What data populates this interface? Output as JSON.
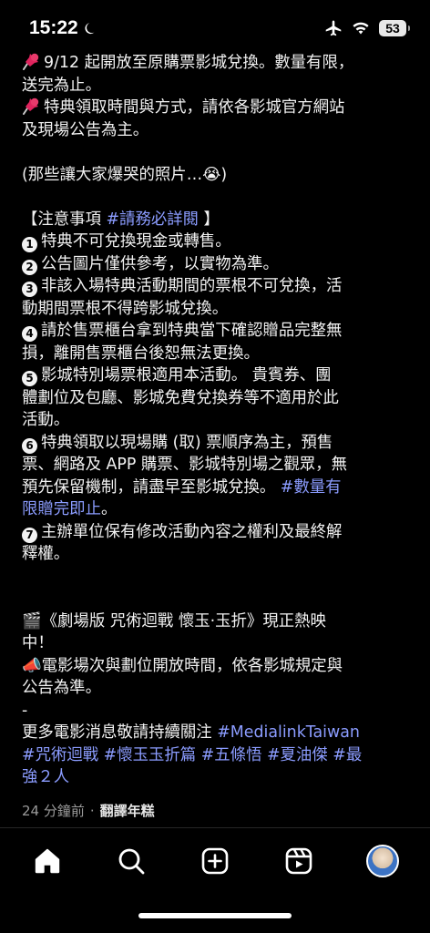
{
  "status_bar": {
    "time": "15:22",
    "battery": "53"
  },
  "post_lines": [
    [
      {
        "t": "pin"
      },
      {
        "s": "9/12 起開放至原購票影城兌換。數量有限，"
      }
    ],
    [
      {
        "s": "送完為止。"
      }
    ],
    [
      {
        "t": "pin"
      },
      {
        "s": "特典領取時間與方式，請依各影城官方網站"
      }
    ],
    [
      {
        "s": "及現場公告為主。"
      }
    ],
    [],
    [
      {
        "s": "(那些讓大家爆哭的照片…😭)"
      }
    ],
    [],
    [
      {
        "s": "【注意事項 "
      },
      {
        "tag": "#請務必詳閱"
      },
      {
        "s": " 】"
      }
    ],
    [
      {
        "n": "1"
      },
      {
        "s": "特典不可兌換現金或轉售。"
      }
    ],
    [
      {
        "n": "2"
      },
      {
        "s": "公告圖片僅供參考，以實物為準。"
      }
    ],
    [
      {
        "n": "3"
      },
      {
        "s": "非該入場特典活動期間的票根不可兌換，活"
      }
    ],
    [
      {
        "s": "動期間票根不得跨影城兌換。"
      }
    ],
    [
      {
        "n": "4"
      },
      {
        "s": "請於售票櫃台拿到特典當下確認贈品完整無"
      }
    ],
    [
      {
        "s": "損，離開售票櫃台後恕無法更換。"
      }
    ],
    [
      {
        "n": "5"
      },
      {
        "s": "影城特別場票根適用本活動。 貴賓券、團"
      }
    ],
    [
      {
        "s": "體劃位及包廳、影城免費兌換券等不適用於此"
      }
    ],
    [
      {
        "s": "活動。"
      }
    ],
    [
      {
        "n": "6"
      },
      {
        "s": "特典領取以現場購 (取) 票順序為主，預售"
      }
    ],
    [
      {
        "s": "票、網路及 APP 購票、影城特別場之觀眾，無"
      }
    ],
    [
      {
        "s": "預先保留機制，請盡早至影城兌換。 "
      },
      {
        "tag": "#數量有"
      }
    ],
    [
      {
        "tag": "限贈完即止"
      },
      {
        "s": "。"
      }
    ],
    [
      {
        "n": "7"
      },
      {
        "s": "主辦單位保有修改活動內容之權利及最終解"
      }
    ],
    [
      {
        "s": "釋權。"
      }
    ],
    [],
    [],
    [
      {
        "s": "🎬《劇場版 咒術迴戰 懷玉·玉折》現正熱映"
      }
    ],
    [
      {
        "s": "中！"
      }
    ],
    [
      {
        "s": "📣電影場次與劃位開放時間，依各影城規定與"
      }
    ],
    [
      {
        "s": "公告為準。"
      }
    ],
    [
      {
        "s": "-"
      }
    ],
    [
      {
        "s": "更多電影消息敬請持續關注 "
      },
      {
        "tag": "#MedialinkTaiwan"
      }
    ],
    [
      {
        "tag": "#咒術迴戰 #懷玉玉折篇 #五條悟 #夏油傑 #最"
      }
    ],
    [
      {
        "tag": "強２人"
      }
    ]
  ],
  "meta": {
    "time_ago": "24 分鐘前",
    "separator": "·",
    "translate": "翻譯年糕"
  },
  "nav": {
    "items": [
      "home-icon",
      "search-icon",
      "create-icon",
      "reels-icon",
      "profile-avatar"
    ]
  },
  "colors": {
    "background": "#000000",
    "text": "#f2f2f2",
    "hashtag": "#8b9cff",
    "meta": "#9a9a9a"
  }
}
